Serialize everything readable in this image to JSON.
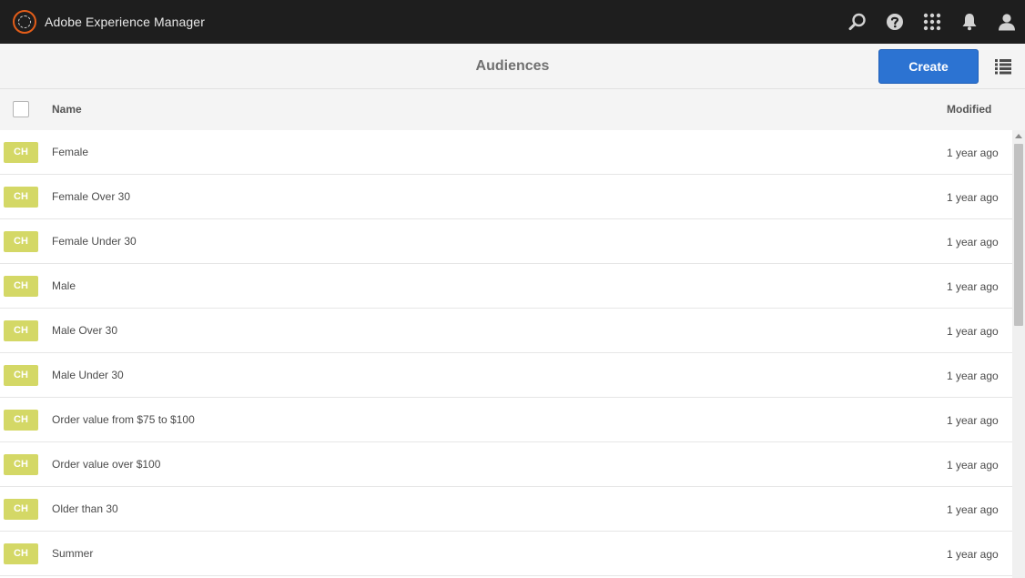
{
  "app": {
    "name": "Adobe Experience Manager",
    "logo_icon": "aem-logo-icon"
  },
  "shell_actions": [
    {
      "name": "search-icon"
    },
    {
      "name": "help-icon"
    },
    {
      "name": "apps-grid-icon"
    },
    {
      "name": "notifications-bell-icon"
    },
    {
      "name": "user-profile-icon"
    }
  ],
  "actionbar": {
    "title": "Audiences",
    "create_label": "Create",
    "view_icon": "list-view-icon"
  },
  "table": {
    "headers": {
      "name": "Name",
      "modified": "Modified"
    },
    "rows": [
      {
        "badge": "CH",
        "name": "Female",
        "modified": "1 year ago"
      },
      {
        "badge": "CH",
        "name": "Female Over 30",
        "modified": "1 year ago"
      },
      {
        "badge": "CH",
        "name": "Female Under 30",
        "modified": "1 year ago"
      },
      {
        "badge": "CH",
        "name": "Male",
        "modified": "1 year ago"
      },
      {
        "badge": "CH",
        "name": "Male Over 30",
        "modified": "1 year ago"
      },
      {
        "badge": "CH",
        "name": "Male Under 30",
        "modified": "1 year ago"
      },
      {
        "badge": "CH",
        "name": "Order value from $75 to $100",
        "modified": "1 year ago"
      },
      {
        "badge": "CH",
        "name": "Order value over $100",
        "modified": "1 year ago"
      },
      {
        "badge": "CH",
        "name": "Older than 30",
        "modified": "1 year ago"
      },
      {
        "badge": "CH",
        "name": "Summer",
        "modified": "1 year ago"
      }
    ]
  },
  "colors": {
    "shell_bg": "#1e1e1e",
    "brand_accent": "#e35d19",
    "primary_button": "#2c73d2",
    "badge_bg": "#d4d866"
  }
}
